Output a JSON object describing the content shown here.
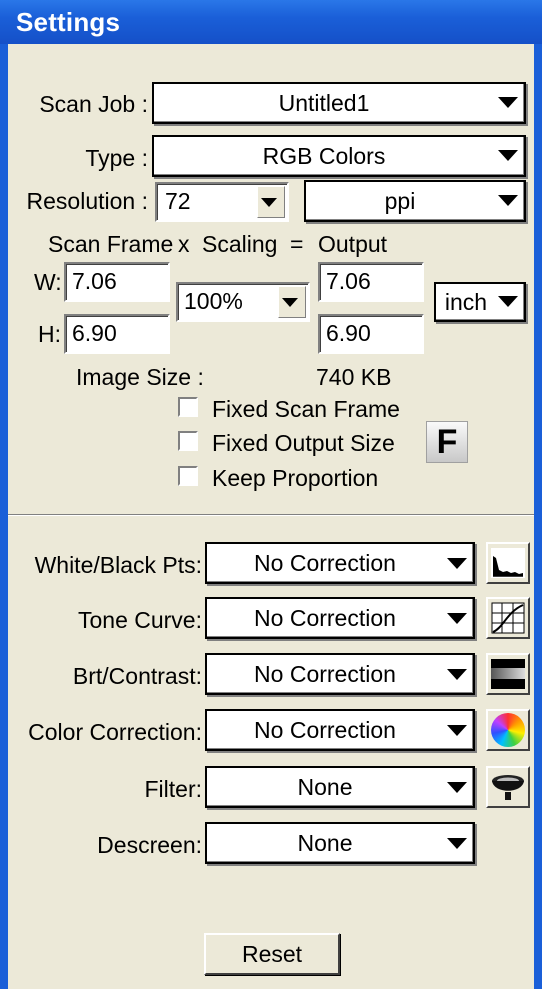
{
  "window": {
    "title": "Settings"
  },
  "scan_job": {
    "label": "Scan Job :",
    "value": "Untitled1"
  },
  "type": {
    "label": "Type :",
    "value": "RGB Colors"
  },
  "resolution": {
    "label": "Resolution :",
    "value": "72",
    "unit": "ppi"
  },
  "scaling_header": {
    "scan_frame": "Scan Frame",
    "x": "x",
    "scaling": "Scaling",
    "eq": "=",
    "output": "Output"
  },
  "width": {
    "label": "W:",
    "value": "7.06",
    "output": "7.06"
  },
  "height": {
    "label": "H:",
    "value": "6.90",
    "output": "6.90"
  },
  "scaling": {
    "value": "100%"
  },
  "unit": {
    "value": "inch"
  },
  "image_size": {
    "label": "Image Size :",
    "value": "740 KB"
  },
  "options": {
    "fixed_scan_frame": {
      "label": "Fixed Scan Frame",
      "checked": false
    },
    "fixed_output_size": {
      "label": "Fixed Output Size",
      "checked": false
    },
    "keep_proportion": {
      "label": "Keep Proportion",
      "checked": false
    }
  },
  "f_button": {
    "label": "F"
  },
  "corrections": {
    "white_black_pts": {
      "label": "White/Black Pts:",
      "value": "No Correction",
      "icon": "histogram-icon"
    },
    "tone_curve": {
      "label": "Tone Curve:",
      "value": "No Correction",
      "icon": "curve-icon"
    },
    "brt_contrast": {
      "label": "Brt/Contrast:",
      "value": "No Correction",
      "icon": "brightness-icon"
    },
    "color_correction": {
      "label": "Color Correction:",
      "value": "No Correction",
      "icon": "color-wheel-icon"
    },
    "filter": {
      "label": "Filter:",
      "value": "None",
      "icon": "filter-bowl-icon"
    },
    "descreen": {
      "label": "Descreen:",
      "value": "None"
    }
  },
  "reset": {
    "label": "Reset"
  }
}
